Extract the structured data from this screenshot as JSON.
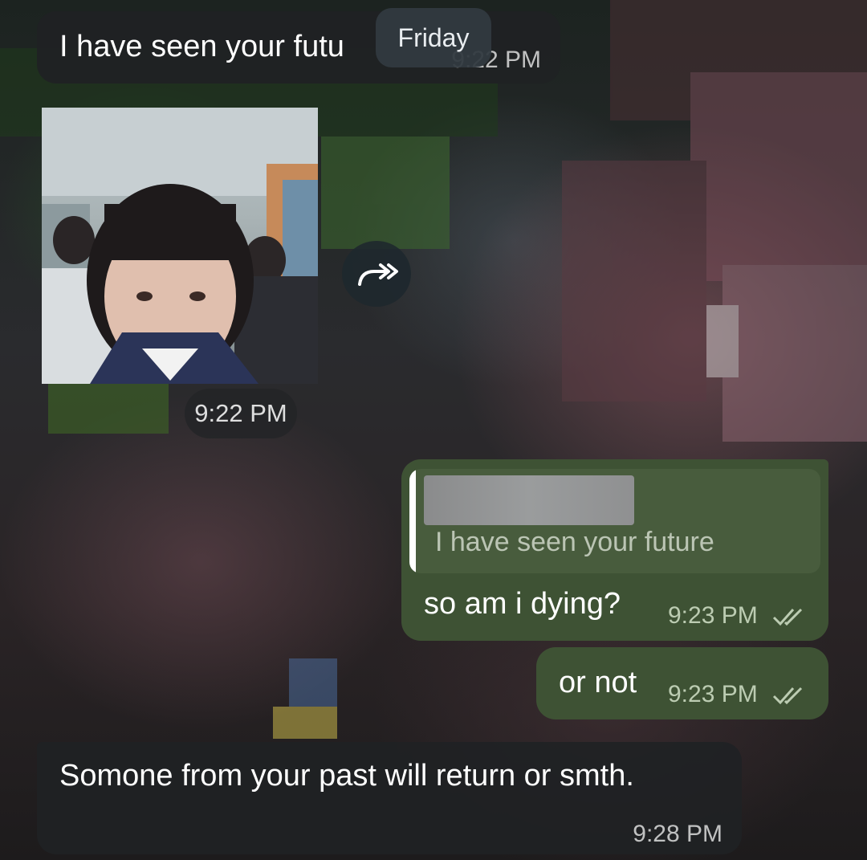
{
  "date_separator": "Friday",
  "messages": [
    {
      "text": "I have seen your futu",
      "time": "9:22 PM",
      "direction": "incoming"
    },
    {
      "type": "photo",
      "time": "9:22 PM",
      "direction": "incoming"
    },
    {
      "reply_to": "I have seen your future",
      "text": "so am i dying?",
      "time": "9:23 PM",
      "direction": "outgoing",
      "status": "read"
    },
    {
      "text": "or not",
      "time": "9:23 PM",
      "direction": "outgoing",
      "status": "read"
    },
    {
      "text": "Somone from your past will return or smth.",
      "time": "9:28 PM",
      "direction": "incoming"
    }
  ],
  "icons": {
    "forward": "forward-arrow-icon",
    "read_receipt": "double-check-icon"
  },
  "colors": {
    "incoming_bubble": "#202224",
    "outgoing_bubble": "#3e5234",
    "reply_bar": "#ffffff"
  }
}
